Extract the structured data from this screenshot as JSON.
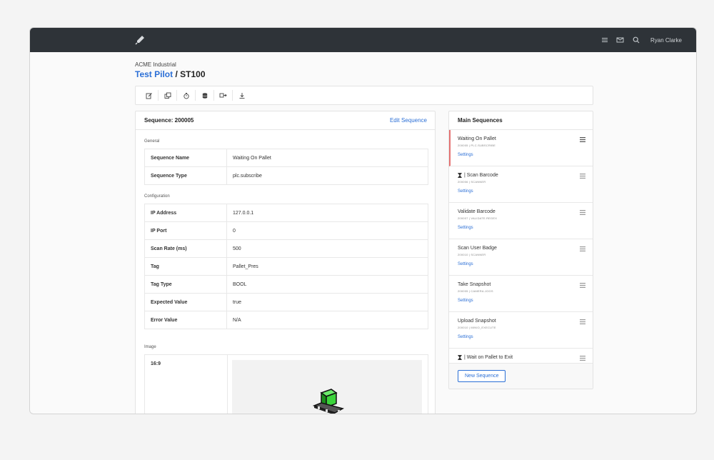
{
  "header": {
    "logo_icon": "rocket-icon",
    "icons": [
      "list-icon",
      "inbox-icon",
      "search-icon"
    ],
    "user_name": "Ryan Clarke"
  },
  "breadcrumb": {
    "company": "ACME Industrial",
    "project": "Test Pilot",
    "separator": " / ",
    "station": "ST100"
  },
  "toolbar": {
    "buttons": [
      "edit-icon",
      "copy-icon",
      "timer-icon",
      "database-icon",
      "sync-icon",
      "download-icon"
    ]
  },
  "sequence": {
    "title": "Sequence: 200005",
    "edit_link": "Edit Sequence",
    "general_label": "General",
    "general": [
      {
        "key": "Sequence Name",
        "value": "Waiting On Pallet"
      },
      {
        "key": "Sequence Type",
        "value": "plc.subscribe"
      }
    ],
    "configuration_label": "Configuration",
    "configuration": [
      {
        "key": "IP Address",
        "value": "127.0.0.1"
      },
      {
        "key": "IP Port",
        "value": "0"
      },
      {
        "key": "Scan Rate (ms)",
        "value": "500"
      },
      {
        "key": "Tag",
        "value": "Pallet_Pres"
      },
      {
        "key": "Tag Type",
        "value": "BOOL"
      },
      {
        "key": "Expected Value",
        "value": "true"
      },
      {
        "key": "Error Value",
        "value": "N/A"
      }
    ],
    "image_label": "Image",
    "image_ratio": "16:9",
    "image_icon": "pallet-box-icon"
  },
  "main_sequences": {
    "title": "Main Sequences",
    "items": [
      {
        "name": "Waiting On Pallet",
        "sub": "200005 | PLC.SUBSCRIBE",
        "settings": "Settings",
        "icon": "",
        "active": true
      },
      {
        "name": "| Scan Barcode",
        "sub": "200006 | SCANNER",
        "settings": "Settings",
        "icon": "hourglass-icon",
        "active": false
      },
      {
        "name": "Validate Barcode",
        "sub": "200007 | VALIDATE.REGEX",
        "settings": "Settings",
        "icon": "",
        "active": false
      },
      {
        "name": "Scan User Badge",
        "sub": "200010 | SCANNER",
        "settings": "Settings",
        "icon": "",
        "active": false
      },
      {
        "name": "Take Snapshot",
        "sub": "200005 | CAMERA.JOGS",
        "settings": "Settings",
        "icon": "",
        "active": false
      },
      {
        "name": "Upload Snapshot",
        "sub": "200010 | MINIO_EXECUTE",
        "settings": "Settings",
        "icon": "",
        "active": false
      },
      {
        "name": "| Wait on Pallet to Exit",
        "sub": "",
        "settings": "",
        "icon": "hourglass-icon",
        "active": false
      }
    ],
    "new_button": "New Sequence"
  },
  "colors": {
    "topbar": "#2e3338",
    "accent": "#2b6fd6",
    "active_marker": "#e57373",
    "pallet_box": "#3bd43b"
  }
}
